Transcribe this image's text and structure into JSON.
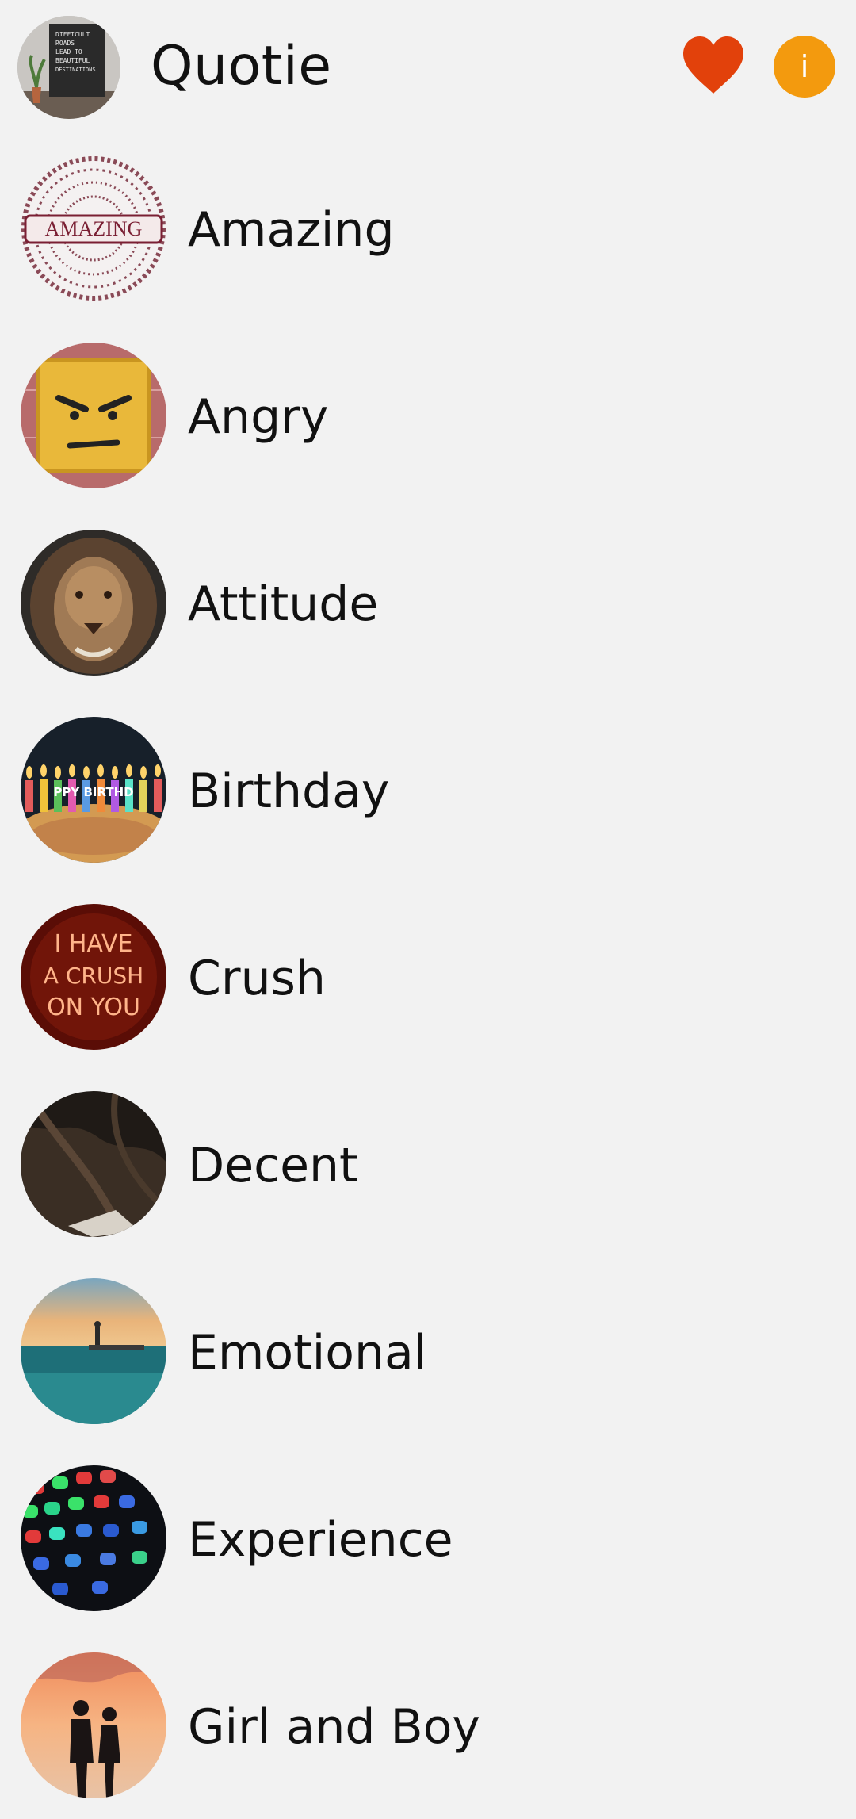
{
  "header": {
    "title": "Quotie",
    "avatar_text": [
      "DIFFICULT",
      "ROADS",
      "LEAD TO",
      "BEAUTIFUL",
      "DESTINATIONS"
    ],
    "favorites_icon": "heart-icon",
    "info_icon": "info-icon",
    "info_glyph": "i",
    "colors": {
      "heart": "#e2410b",
      "info": "#f39a0e"
    }
  },
  "categories": [
    {
      "label": "Amazing",
      "image_text": "AMAZING"
    },
    {
      "label": "Angry"
    },
    {
      "label": "Attitude"
    },
    {
      "label": "Birthday",
      "image_text": "PPY BIRTHD"
    },
    {
      "label": "Crush",
      "image_text": [
        "I HAVE",
        "A CRUSH",
        "ON YOU"
      ]
    },
    {
      "label": "Decent"
    },
    {
      "label": "Emotional"
    },
    {
      "label": "Experience"
    },
    {
      "label": "Girl and Boy"
    }
  ]
}
